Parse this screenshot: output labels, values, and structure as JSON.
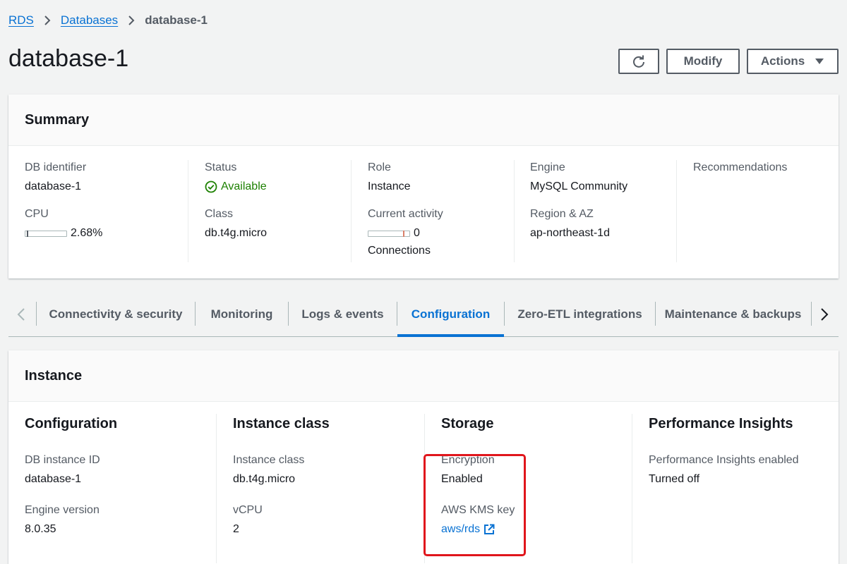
{
  "breadcrumb": {
    "root": "RDS",
    "parent": "Databases",
    "current": "database-1"
  },
  "page": {
    "title": "database-1"
  },
  "header_actions": {
    "modify": "Modify",
    "actions": "Actions"
  },
  "summary": {
    "title": "Summary",
    "db_identifier": {
      "label": "DB identifier",
      "value": "database-1"
    },
    "cpu": {
      "label": "CPU",
      "value": "2.68%",
      "fraction": 0.0268
    },
    "status": {
      "label": "Status",
      "value": "Available"
    },
    "class": {
      "label": "Class",
      "value": "db.t4g.micro"
    },
    "role": {
      "label": "Role",
      "value": "Instance"
    },
    "current_activity": {
      "label": "Current activity",
      "value": "0",
      "unit": "Connections"
    },
    "engine": {
      "label": "Engine",
      "value": "MySQL Community"
    },
    "region": {
      "label": "Region & AZ",
      "value": "ap-northeast-1d"
    },
    "recommendations": {
      "label": "Recommendations"
    }
  },
  "tabs": [
    {
      "label": "Connectivity & security"
    },
    {
      "label": "Monitoring"
    },
    {
      "label": "Logs & events"
    },
    {
      "label": "Configuration",
      "active": true
    },
    {
      "label": "Zero-ETL integrations"
    },
    {
      "label": "Maintenance & backups"
    }
  ],
  "instance": {
    "title": "Instance",
    "configuration": {
      "heading": "Configuration",
      "db_instance_id": {
        "label": "DB instance ID",
        "value": "database-1"
      },
      "engine_version": {
        "label": "Engine version",
        "value": "8.0.35"
      }
    },
    "instance_class": {
      "heading": "Instance class",
      "class": {
        "label": "Instance class",
        "value": "db.t4g.micro"
      },
      "vcpu": {
        "label": "vCPU",
        "value": "2"
      }
    },
    "storage": {
      "heading": "Storage",
      "encryption": {
        "label": "Encryption",
        "value": "Enabled"
      },
      "kms_key": {
        "label": "AWS KMS key",
        "value": "aws/rds"
      }
    },
    "performance_insights": {
      "heading": "Performance Insights",
      "enabled": {
        "label": "Performance Insights enabled",
        "value": "Turned off"
      }
    }
  },
  "colors": {
    "link": "#0972d3",
    "success": "#1d8102",
    "highlight": "#e0161c",
    "meter_marker": "#d9806a"
  },
  "icons": [
    "refresh-icon",
    "caret-down-icon",
    "chevron-right-icon",
    "chevron-left-icon",
    "status-check-icon",
    "external-link-icon"
  ]
}
